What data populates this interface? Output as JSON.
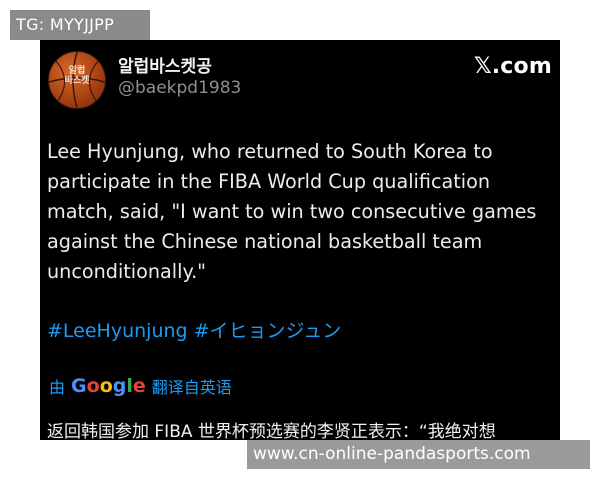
{
  "overlay_tag": "TG: MYYJJPP",
  "post": {
    "avatar_text": "알럽\n바스켓",
    "display_name": "알럽바스켓공",
    "handle": "@baekpd1983",
    "platform_logo": "𝕏.com",
    "body_lines": [
      "Lee Hyunjung, who returned to South Korea to",
      "participate in the FIBA World Cup qualification",
      "match, said, \"I want to win two consecutive games",
      "against the Chinese national basketball team",
      "unconditionally.\""
    ],
    "hashtags": "#LeeHyunjung #イヒョンジュン",
    "translate": {
      "prefix": "由",
      "google_letters": [
        "G",
        "o",
        "o",
        "g",
        "l",
        "e"
      ],
      "suffix": "翻译自英语"
    },
    "translated_text": "返回韩国参加 FIBA 世界杯预选赛的李贤正表示：“我绝对想"
  },
  "watermark": "www.cn-online-pandasports.com",
  "colors": {
    "card_bg": "#000000",
    "link_blue": "#1d9bf0",
    "handle_gray": "#8b8f94",
    "overlay_gray": "#8a8a8a"
  },
  "icons": {
    "avatar": "basketball-avatar-icon",
    "logo": "x-logo-icon"
  }
}
